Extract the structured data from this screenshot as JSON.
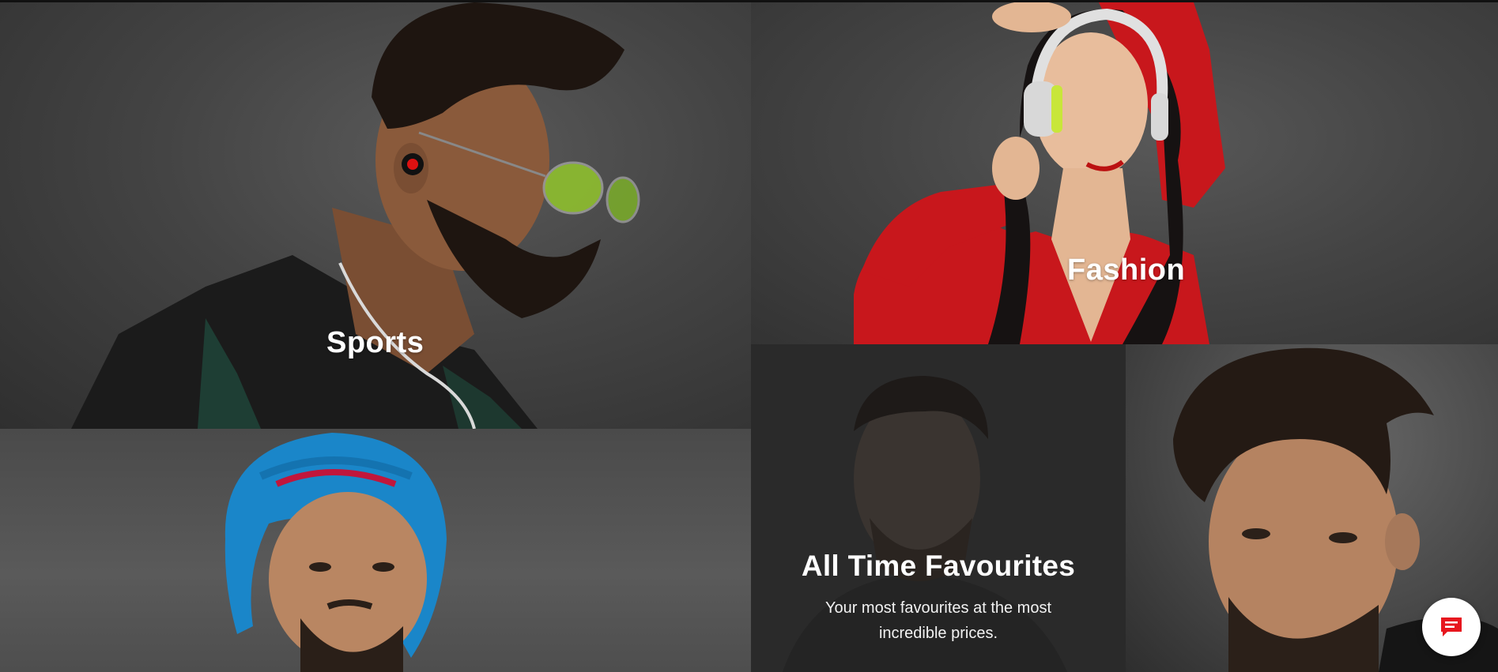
{
  "tiles": {
    "sports": {
      "label": "Sports"
    },
    "fashion": {
      "label": "Fashion"
    },
    "favourites": {
      "title": "All Time Favourites",
      "subtitle": "Your most favourites at the most incredible prices."
    }
  },
  "chat": {
    "icon": "chat-icon"
  },
  "colors": {
    "chat_icon": "#e7161e",
    "text": "#ffffff"
  }
}
